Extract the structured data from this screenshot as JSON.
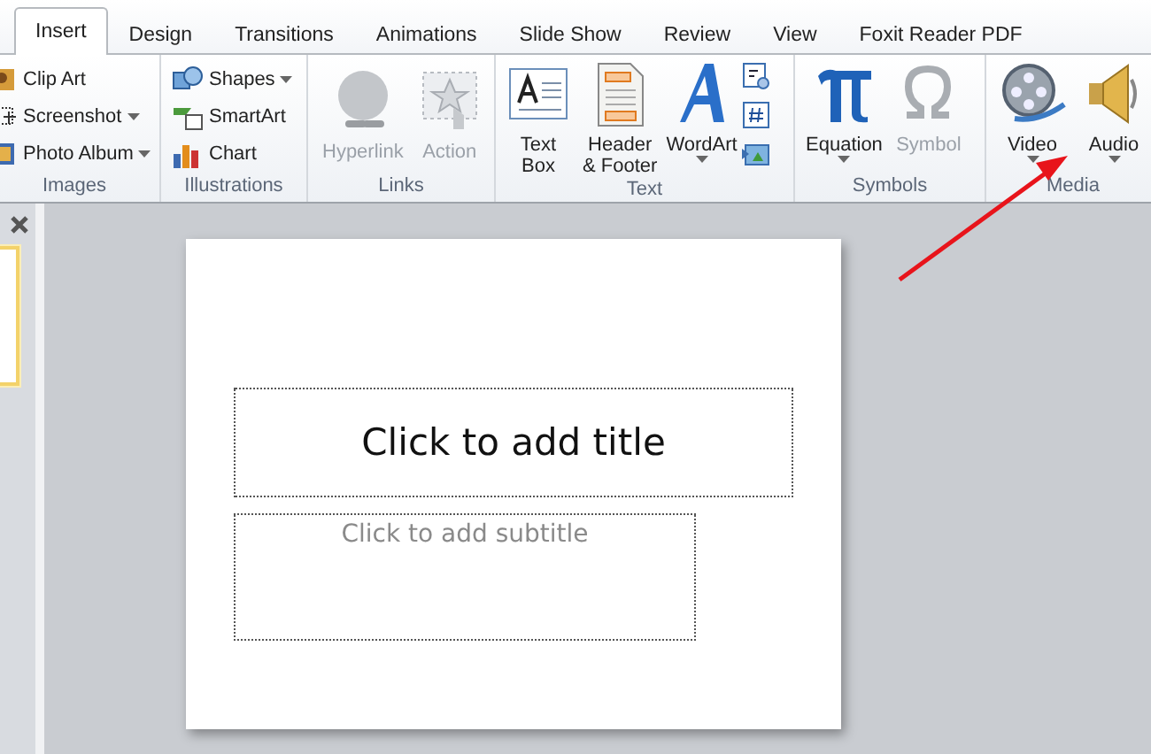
{
  "tabs": [
    {
      "label": "Insert",
      "selected": true
    },
    {
      "label": "Design",
      "selected": false
    },
    {
      "label": "Transitions",
      "selected": false
    },
    {
      "label": "Animations",
      "selected": false
    },
    {
      "label": "Slide Show",
      "selected": false
    },
    {
      "label": "Review",
      "selected": false
    },
    {
      "label": "View",
      "selected": false
    },
    {
      "label": "Foxit Reader PDF",
      "selected": false
    }
  ],
  "ribbon": {
    "groups": [
      {
        "label": "Images",
        "items": [
          {
            "kind": "small",
            "label": "Clip Art",
            "dropdown": false,
            "disabled": false
          },
          {
            "kind": "small",
            "label": "Screenshot",
            "dropdown": true,
            "disabled": false
          },
          {
            "kind": "small",
            "label": "Photo Album",
            "dropdown": true,
            "disabled": false
          }
        ]
      },
      {
        "label": "Illustrations",
        "items": [
          {
            "kind": "small",
            "label": "Shapes",
            "dropdown": true,
            "disabled": false
          },
          {
            "kind": "small",
            "label": "SmartArt",
            "dropdown": false,
            "disabled": false
          },
          {
            "kind": "small",
            "label": "Chart",
            "dropdown": false,
            "disabled": false
          }
        ]
      },
      {
        "label": "Links",
        "items": [
          {
            "kind": "large",
            "label": "Hyperlink",
            "dropdown": false,
            "disabled": true
          },
          {
            "kind": "large",
            "label": "Action",
            "dropdown": false,
            "disabled": true
          }
        ]
      },
      {
        "label": "Text",
        "items": [
          {
            "kind": "large",
            "label": "Text\nBox",
            "dropdown": false,
            "disabled": false
          },
          {
            "kind": "large",
            "label": "Header\n& Footer",
            "dropdown": false,
            "disabled": false
          },
          {
            "kind": "large",
            "label": "WordArt",
            "dropdown": true,
            "disabled": false
          },
          {
            "kind": "iconstack"
          }
        ]
      },
      {
        "label": "Symbols",
        "items": [
          {
            "kind": "large",
            "label": "Equation",
            "dropdown": true,
            "disabled": false
          },
          {
            "kind": "large",
            "label": "Symbol",
            "dropdown": false,
            "disabled": true
          }
        ]
      },
      {
        "label": "Media",
        "items": [
          {
            "kind": "large",
            "label": "Video",
            "dropdown": true,
            "disabled": false
          },
          {
            "kind": "large",
            "label": "Audio",
            "dropdown": true,
            "disabled": false
          }
        ]
      }
    ]
  },
  "slide": {
    "title_placeholder": "Click to add title",
    "subtitle_placeholder": "Click to add subtitle"
  },
  "annotation": {
    "kind": "arrow",
    "color": "#e8141b"
  }
}
